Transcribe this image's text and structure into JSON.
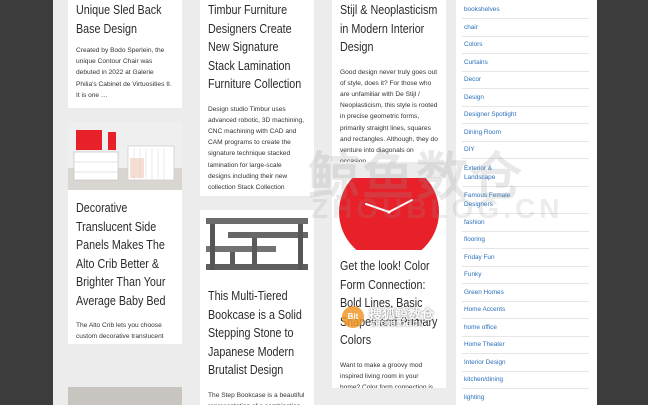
{
  "posts": [
    {
      "title": "Unique Sled Back Base Design",
      "excerpt": "Created by Bodo Sperlein, the unique Contour Chair was debuted in 2022 at Galerie Philia's Cabinet de Virtuosities II. It is one …"
    },
    {
      "title": "Timbur Furniture Designers Create New Signature Stack Lamination Furniture Collection",
      "excerpt": "Design studio Timbur uses advanced robotic, 3D machining, CNC machining with CAD and CAM programs to create the signature technique stacked lamination for large-scale designs including their new collection Stack Collection"
    },
    {
      "title": "Stijl & Neoplasticism in Modern Interior Design",
      "excerpt": "Good design never truly goes out of style, does it? For those who are unfamiliar with De Stijl / Neoplasticism, this style is rooted in precise geometric forms, primarily straight lines, squares and rectangles. Although, they do venture into diagonals on occasion."
    },
    {
      "title": "Decorative Translucent Side Panels Makes The Alto Crib Better & Brighter Than Your Average Baby Bed",
      "excerpt": "The Alto Crib lets you choose custom decorative translucent side panels to make your babies crib look badass! | padstyle.com"
    },
    {
      "title": "This Multi-Tiered Bookcase is a Solid Stepping Stone to Japanese Modern Brutalist Design",
      "excerpt": "The Step Bookcase is a beautiful representation of a combination"
    },
    {
      "title": "Get the look! Color Form Connection: Bold Lines, Basic Shapes and Primary Colors",
      "excerpt": "Want to make a groovy mod inspired living room in your home? Color form connection is our pure take using bold lines, …"
    }
  ],
  "sidebar": {
    "categories": [
      "bookshelves",
      "chair",
      "Colors",
      "Curtains",
      "Decor",
      "Design",
      "Designer Spotlight",
      "Dining Room",
      "DIY",
      "Exterior & Landscape",
      "Famous Female Designers",
      "fashion",
      "flooring",
      "Friday Fun",
      "Funky",
      "Green Homes",
      "Home Accents",
      "home office",
      "Home Theater",
      "Interior Design",
      "kitchen/dining",
      "lighting"
    ]
  },
  "watermark": {
    "large_cn": "鲸鱼数仓",
    "large_latin": "ZHOUBLOG.CN",
    "small_logo": "Bit",
    "small_cn": "搜狐鲸数仓",
    "small_latin": "ZHOUBLOG.CN"
  },
  "colors": {
    "link": "#2a6fbb",
    "accent_red": "#e8202a",
    "page_bg": "#ececec",
    "frame_bg": "#3c3c3c"
  }
}
